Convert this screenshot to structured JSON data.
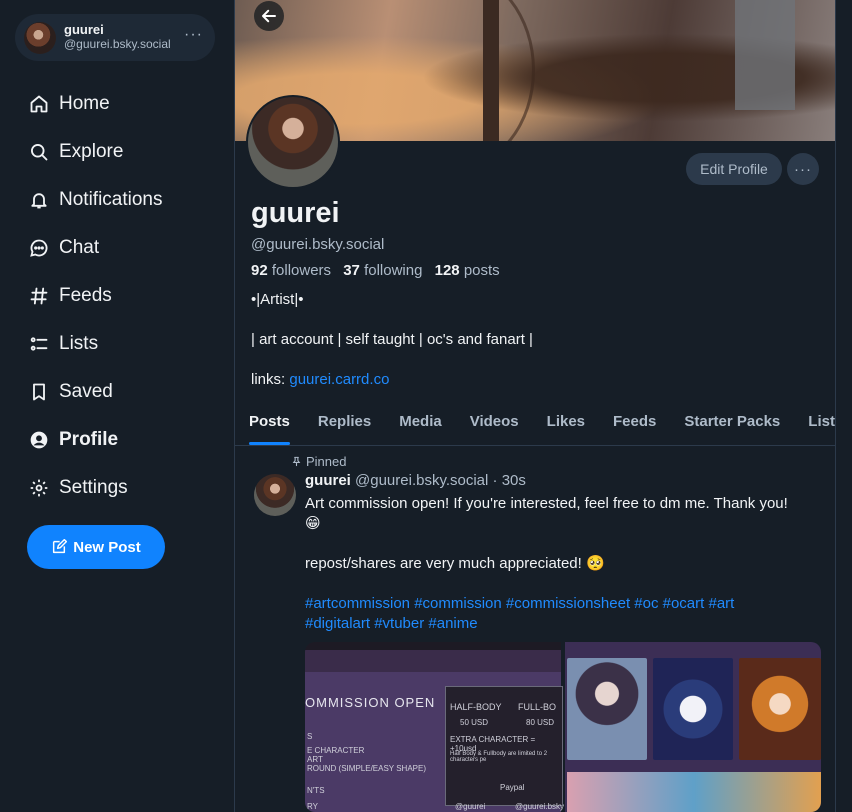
{
  "account": {
    "name": "guurei",
    "handle": "@guurei.bsky.social",
    "menu": "···"
  },
  "nav": [
    {
      "label": "Home",
      "icon": "home-icon"
    },
    {
      "label": "Explore",
      "icon": "search-icon"
    },
    {
      "label": "Notifications",
      "icon": "bell-icon"
    },
    {
      "label": "Chat",
      "icon": "chat-icon"
    },
    {
      "label": "Feeds",
      "icon": "hash-icon"
    },
    {
      "label": "Lists",
      "icon": "list-icon"
    },
    {
      "label": "Saved",
      "icon": "bookmark-icon"
    },
    {
      "label": "Profile",
      "icon": "user-icon",
      "active": true
    },
    {
      "label": "Settings",
      "icon": "gear-icon"
    }
  ],
  "new_post_label": "New Post",
  "profile": {
    "display_name": "guurei",
    "handle": "@guurei.bsky.social",
    "edit_label": "Edit Profile",
    "more": "···",
    "followers_count": "92",
    "followers_label": "followers",
    "following_count": "37",
    "following_label": "following",
    "posts_count": "128",
    "posts_label": "posts",
    "bio_line1": "•|Artist|•",
    "bio_line2": "| art account | self taught | oc's and fanart |",
    "links_label": "links:",
    "link_text": "guurei.carrd.co"
  },
  "tabs": [
    "Posts",
    "Replies",
    "Media",
    "Videos",
    "Likes",
    "Feeds",
    "Starter Packs",
    "Lists"
  ],
  "post": {
    "pinned_label": "Pinned",
    "author_name": "guurei",
    "author_handle": "@guurei.bsky.social",
    "time": "· 30s",
    "line1": "Art commission open! If you're interested, feel free to dm me. Thank you!",
    "line1_emoji": "😁",
    "line2": "repost/shares are very much appreciated! 🥺",
    "hashtags_line1": "#artcommission #commission #commissionsheet #oc #ocart #art",
    "hashtags_line2": "#digitalart #vtuber #anime",
    "image1_text": {
      "title": "OMMISSION OPEN",
      "half_body": "HALF-BODY",
      "full_body": "FULL-BO",
      "price1": "50 USD",
      "price2": "80 USD",
      "extra": "EXTRA CHARACTER = +10usd",
      "note": "Half Body & Fullbody are limited to 2 characters pe",
      "paypal": "Paypal",
      "left_s": "S",
      "left_char": "E CHARACTER",
      "left_art": "ART",
      "left_bg": "ROUND (SIMPLE/EASY SHAPE)",
      "left_ts": "N'TS",
      "left_y": "RY",
      "footer1": "@guurei",
      "footer2": "@guurei.bsky"
    }
  },
  "colors": {
    "accent": "#1083fe",
    "background": "#161e27",
    "link": "#208bfe"
  }
}
